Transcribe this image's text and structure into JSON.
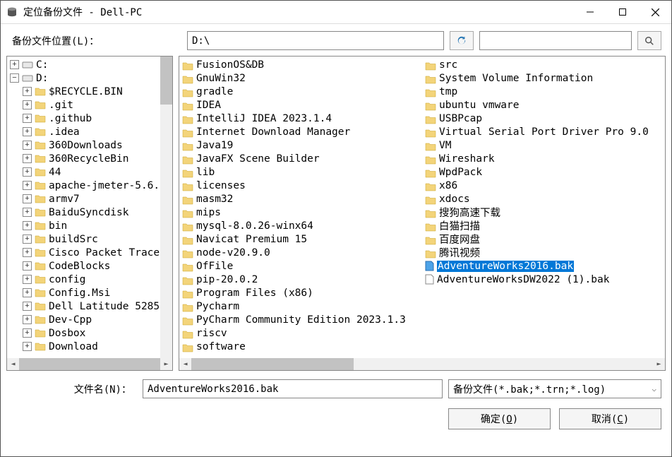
{
  "window": {
    "title": "定位备份文件 - Dell-PC"
  },
  "location": {
    "label": "备份文件位置(L)：",
    "path": "D:\\"
  },
  "search": {
    "value": ""
  },
  "tree": {
    "root_c": "C:",
    "root_d": "D:",
    "d_children": [
      "$RECYCLE.BIN",
      ".git",
      ".github",
      ".idea",
      "360Downloads",
      "360RecycleBin",
      "44",
      "apache-jmeter-5.6.",
      "armv7",
      "BaiduSyncdisk",
      "bin",
      "buildSrc",
      "Cisco Packet Trace",
      "CodeBlocks",
      "config",
      "Config.Msi",
      "Dell Latitude 5285",
      "Dev-Cpp",
      "Dosbox",
      "Download"
    ]
  },
  "list": {
    "col1": [
      "FusionOS&DB",
      "GnuWin32",
      "gradle",
      "IDEA",
      "IntelliJ IDEA 2023.1.4",
      "Internet Download Manager",
      "Java19",
      "JavaFX Scene Builder",
      "lib",
      "licenses",
      "masm32",
      "mips",
      "mysql-8.0.26-winx64",
      "Navicat Premium 15",
      "node-v20.9.0",
      "OfFile",
      "pip-20.0.2",
      "Program Files (x86)",
      "Pycharm",
      "PyCharm Community Edition 2023.1.3",
      "riscv",
      "software"
    ],
    "col2_folders": [
      "src",
      "System Volume Information",
      "tmp",
      "ubuntu vmware",
      "USBPcap",
      "Virtual Serial Port Driver Pro 9.0",
      "VM",
      "Wireshark",
      "WpdPack",
      "x86",
      "xdocs",
      "搜狗高速下载",
      "白猫扫描",
      "百度网盘",
      "腾讯视频"
    ],
    "col2_files": [
      {
        "name": "AdventureWorks2016.bak",
        "selected": true
      },
      {
        "name": "AdventureWorksDW2022 (1).bak",
        "selected": false
      }
    ]
  },
  "filename": {
    "label": "文件名(N)：",
    "value": "AdventureWorks2016.bak"
  },
  "filter": {
    "text": "备份文件(*.bak;*.trn;*.log)"
  },
  "buttons": {
    "ok_pre": "确定(",
    "ok_key": "O",
    "ok_post": ")",
    "cancel_pre": "取消(",
    "cancel_key": "C",
    "cancel_post": ")"
  }
}
